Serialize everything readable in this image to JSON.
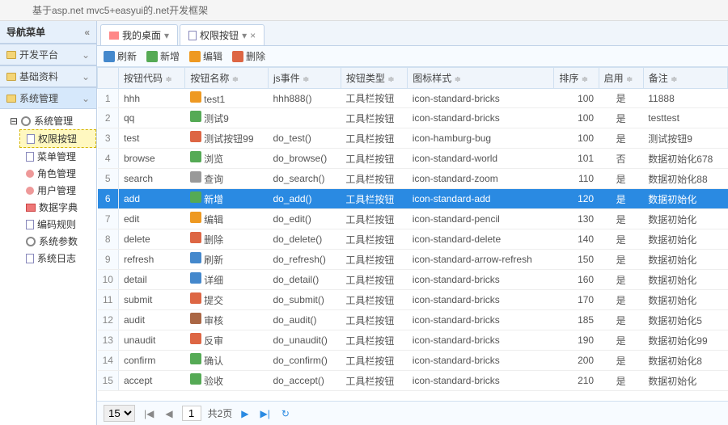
{
  "header": {
    "subtitle": "基于asp.net mvc5+easyui的.net开发框架"
  },
  "nav": {
    "title": "导航菜单",
    "panels": [
      {
        "label": "开发平台"
      },
      {
        "label": "基础资料"
      },
      {
        "label": "系统管理"
      }
    ],
    "tree_root": "系统管理",
    "items": [
      {
        "label": "权限按钮",
        "selected": true
      },
      {
        "label": "菜单管理"
      },
      {
        "label": "角色管理"
      },
      {
        "label": "用户管理"
      },
      {
        "label": "数据字典"
      },
      {
        "label": "编码规则"
      },
      {
        "label": "系统参数"
      },
      {
        "label": "系统日志"
      }
    ]
  },
  "tabs": [
    {
      "label": "我的桌面",
      "icon": "home"
    },
    {
      "label": "权限按钮",
      "icon": "page"
    }
  ],
  "toolbar": [
    {
      "label": "刷新",
      "icon": "refresh"
    },
    {
      "label": "新增",
      "icon": "add"
    },
    {
      "label": "编辑",
      "icon": "edit"
    },
    {
      "label": "删除",
      "icon": "delete"
    }
  ],
  "columns": [
    {
      "label": "按钮代码"
    },
    {
      "label": "按钮名称"
    },
    {
      "label": "js事件"
    },
    {
      "label": "按钮类型"
    },
    {
      "label": "图标样式"
    },
    {
      "label": "排序"
    },
    {
      "label": "启用"
    },
    {
      "label": "备注"
    }
  ],
  "rows": [
    {
      "code": "hhh",
      "name": "test1",
      "icon": "orange",
      "js": "hhh888()",
      "type": "工具栏按钮",
      "style": "icon-standard-bricks",
      "order": 100,
      "enable": "是",
      "remark": "11888"
    },
    {
      "code": "qq",
      "name": "测试9",
      "icon": "green",
      "js": "",
      "type": "工具栏按钮",
      "style": "icon-standard-bricks",
      "order": 100,
      "enable": "是",
      "remark": "testtest"
    },
    {
      "code": "test",
      "name": "测试按钮99",
      "icon": "red",
      "js": "do_test()",
      "type": "工具栏按钮",
      "style": "icon-hamburg-bug",
      "order": 100,
      "enable": "是",
      "remark": "测试按钮9"
    },
    {
      "code": "browse",
      "name": "浏览",
      "icon": "green",
      "js": "do_browse()",
      "type": "工具栏按钮",
      "style": "icon-standard-world",
      "order": 101,
      "enable": "否",
      "remark": "数据初始化678"
    },
    {
      "code": "search",
      "name": "查询",
      "icon": "gray",
      "js": "do_search()",
      "type": "工具栏按钮",
      "style": "icon-standard-zoom",
      "order": 110,
      "enable": "是",
      "remark": "数据初始化88"
    },
    {
      "code": "add",
      "name": "新增",
      "icon": "green",
      "js": "do_add()",
      "type": "工具栏按钮",
      "style": "icon-standard-add",
      "order": 120,
      "enable": "是",
      "remark": "数据初始化",
      "selected": true
    },
    {
      "code": "edit",
      "name": "编辑",
      "icon": "orange",
      "js": "do_edit()",
      "type": "工具栏按钮",
      "style": "icon-standard-pencil",
      "order": 130,
      "enable": "是",
      "remark": "数据初始化"
    },
    {
      "code": "delete",
      "name": "删除",
      "icon": "red",
      "js": "do_delete()",
      "type": "工具栏按钮",
      "style": "icon-standard-delete",
      "order": 140,
      "enable": "是",
      "remark": "数据初始化"
    },
    {
      "code": "refresh",
      "name": "刷新",
      "icon": "blue",
      "js": "do_refresh()",
      "type": "工具栏按钮",
      "style": "icon-standard-arrow-refresh",
      "order": 150,
      "enable": "是",
      "remark": "数据初始化"
    },
    {
      "code": "detail",
      "name": "详细",
      "icon": "blue",
      "js": "do_detail()",
      "type": "工具栏按钮",
      "style": "icon-standard-bricks",
      "order": 160,
      "enable": "是",
      "remark": "数据初始化"
    },
    {
      "code": "submit",
      "name": "提交",
      "icon": "red",
      "js": "do_submit()",
      "type": "工具栏按钮",
      "style": "icon-standard-bricks",
      "order": 170,
      "enable": "是",
      "remark": "数据初始化"
    },
    {
      "code": "audit",
      "name": "审核",
      "icon": "brown",
      "js": "do_audit()",
      "type": "工具栏按钮",
      "style": "icon-standard-bricks",
      "order": 185,
      "enable": "是",
      "remark": "数据初始化5"
    },
    {
      "code": "unaudit",
      "name": "反审",
      "icon": "red",
      "js": "do_unaudit()",
      "type": "工具栏按钮",
      "style": "icon-standard-bricks",
      "order": 190,
      "enable": "是",
      "remark": "数据初始化99"
    },
    {
      "code": "confirm",
      "name": "确认",
      "icon": "green",
      "js": "do_confirm()",
      "type": "工具栏按钮",
      "style": "icon-standard-bricks",
      "order": 200,
      "enable": "是",
      "remark": "数据初始化8"
    },
    {
      "code": "accept",
      "name": "验收",
      "icon": "green",
      "js": "do_accept()",
      "type": "工具栏按钮",
      "style": "icon-standard-bricks",
      "order": 210,
      "enable": "是",
      "remark": "数据初始化"
    }
  ],
  "pager": {
    "page_size": "15",
    "current_page": "1",
    "total_pages": "共2页"
  }
}
